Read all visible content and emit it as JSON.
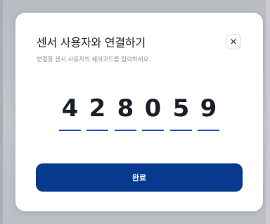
{
  "modal": {
    "title": "센서 사용자와 연결하기",
    "subtitle": "연결할 센서 사용자의 쉐어코드를 입력하세요.",
    "close_icon": "close-icon",
    "code_digits": [
      "4",
      "2",
      "8",
      "0",
      "5",
      "9"
    ],
    "confirm_label": "완료"
  },
  "colors": {
    "accent": "#073a8f",
    "underline": "#1f56b8"
  }
}
